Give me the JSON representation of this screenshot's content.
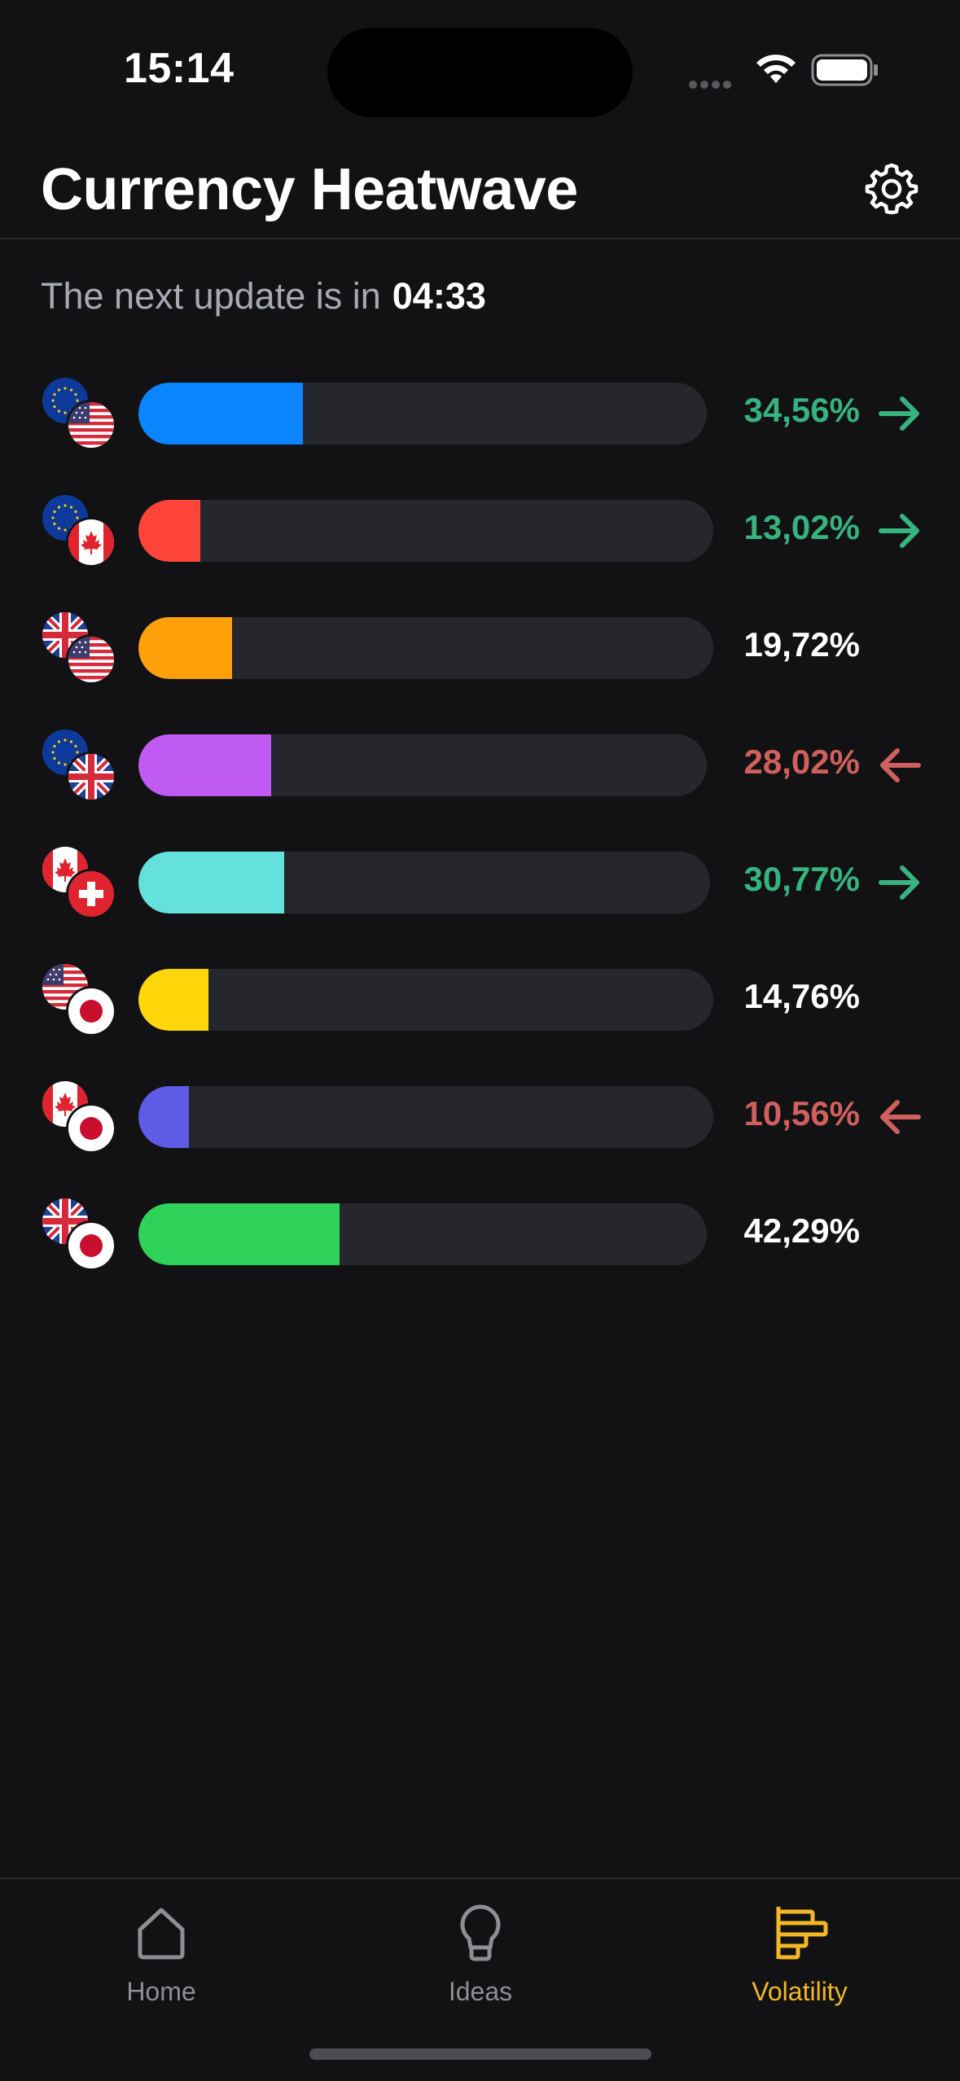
{
  "status_bar": {
    "time": "15:14"
  },
  "header": {
    "title": "Currency Heatwave",
    "settings_icon": "gear-icon"
  },
  "update": {
    "text": "The next update is in",
    "countdown": "04:33"
  },
  "colors": {
    "up": "#36b37e",
    "down": "#d0605e",
    "neutral": "#ffffff",
    "accent": "#f2b824",
    "track": "#26272c"
  },
  "pairs": [
    {
      "base": "eu",
      "quote": "us",
      "value": "34,56%",
      "level": 0.3456,
      "trend": "up",
      "color": "#0a84ff"
    },
    {
      "base": "eu",
      "quote": "ca",
      "value": "13,02%",
      "level": 0.1302,
      "trend": "up",
      "color": "#ff453a"
    },
    {
      "base": "gb",
      "quote": "us",
      "value": "19,72%",
      "level": 0.1972,
      "trend": "neutral",
      "color": "#ff9f0a"
    },
    {
      "base": "eu",
      "quote": "gb",
      "value": "28,02%",
      "level": 0.2802,
      "trend": "down",
      "color": "#bf5af2"
    },
    {
      "base": "ca",
      "quote": "ch",
      "value": "30,77%",
      "level": 0.3077,
      "trend": "up",
      "color": "#64e1dc"
    },
    {
      "base": "us",
      "quote": "jp",
      "value": "14,76%",
      "level": 0.1476,
      "trend": "neutral",
      "color": "#ffd60a"
    },
    {
      "base": "ca",
      "quote": "jp",
      "value": "10,56%",
      "level": 0.1056,
      "trend": "down",
      "color": "#5e5ce6"
    },
    {
      "base": "gb",
      "quote": "jp",
      "value": "42,29%",
      "level": 0.4229,
      "trend": "neutral",
      "color": "#30d158"
    }
  ],
  "tabbar": {
    "tabs": [
      {
        "label": "Home",
        "icon": "home-icon",
        "active": false
      },
      {
        "label": "Ideas",
        "icon": "lightbulb-icon",
        "active": false
      },
      {
        "label": "Volatility",
        "icon": "volatility-icon",
        "active": true
      }
    ]
  }
}
